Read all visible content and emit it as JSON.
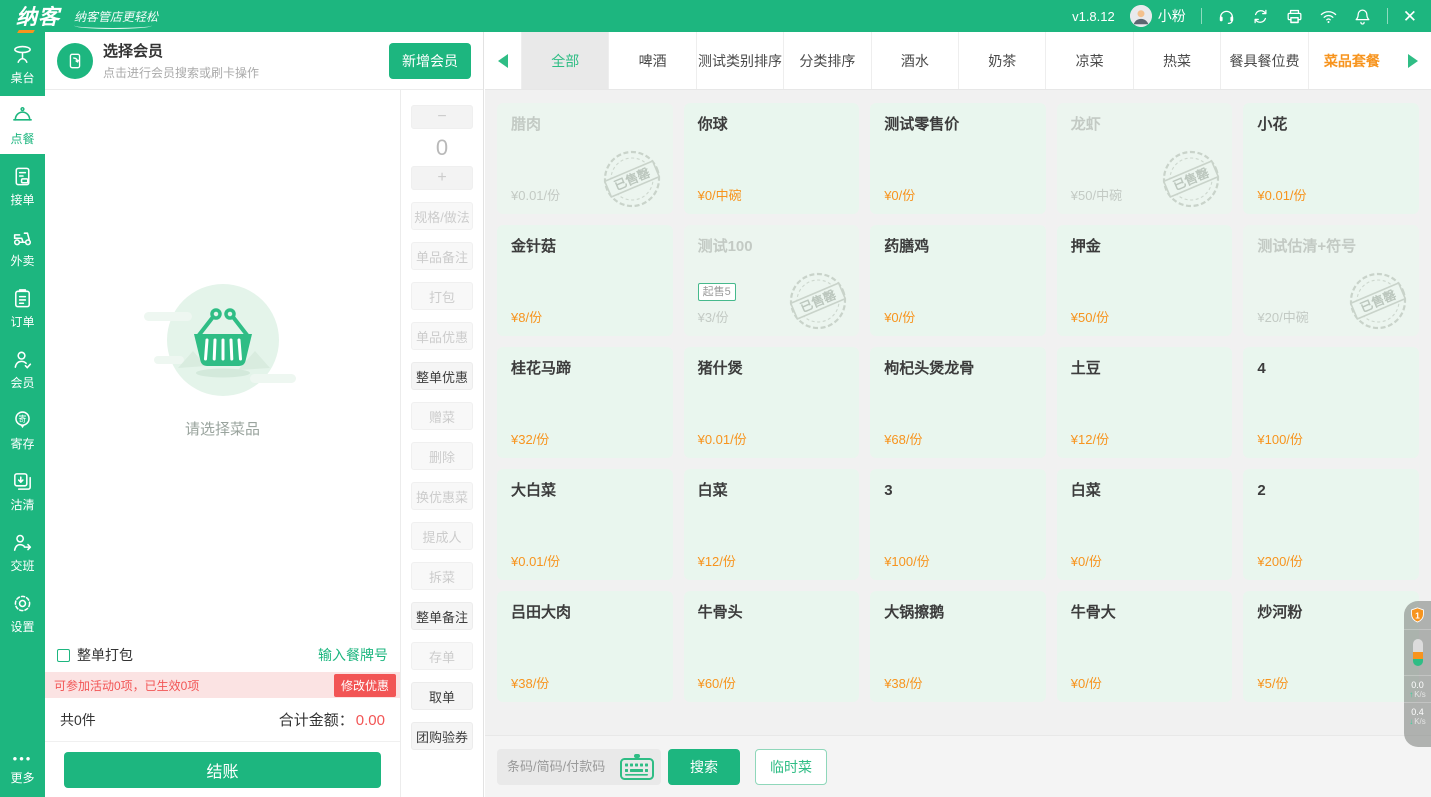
{
  "app": {
    "logo": "纳客",
    "slogan": "纳客管店更轻松",
    "version": "v1.8.12",
    "user": "小粉"
  },
  "sidebar": {
    "items": [
      {
        "id": "tables",
        "label": "桌台",
        "icon": "table-icon",
        "active": false
      },
      {
        "id": "order",
        "label": "点餐",
        "icon": "cloche-icon",
        "active": true
      },
      {
        "id": "accept",
        "label": "接单",
        "icon": "receipt-icon",
        "active": false
      },
      {
        "id": "takeout",
        "label": "外卖",
        "icon": "scooter-icon",
        "active": false
      },
      {
        "id": "orders",
        "label": "订单",
        "icon": "clipboard-icon",
        "active": false
      },
      {
        "id": "members",
        "label": "会员",
        "icon": "member-icon",
        "active": false
      },
      {
        "id": "deposit",
        "label": "寄存",
        "icon": "deposit-pin-icon",
        "active": false
      },
      {
        "id": "sellout",
        "label": "沽清",
        "icon": "soldout-pages-icon",
        "active": false
      },
      {
        "id": "shift",
        "label": "交班",
        "icon": "shift-icon",
        "active": false
      },
      {
        "id": "settings",
        "label": "设置",
        "icon": "gear-icon",
        "active": false
      }
    ],
    "more": {
      "id": "more",
      "label": "更多",
      "icon": "more-dots-icon"
    }
  },
  "member_panel": {
    "title": "选择会员",
    "subtitle": "点击进行会员搜索或刷卡操作",
    "add_button": "新增会员",
    "empty_text": "请选择菜品",
    "pack_label": "整单打包",
    "table_no_link": "输入餐牌号",
    "activity_text": "可参加活动0项，已生效0项",
    "modify_discount": "修改优惠",
    "count_text": "共0件",
    "total_label": "合计金额：",
    "total_value": "0.00",
    "checkout": "结账"
  },
  "actions": {
    "minus_label": "−",
    "qty": "0",
    "plus_label": "+",
    "buttons": [
      {
        "id": "spec",
        "label": "规格/做法",
        "enabled": false
      },
      {
        "id": "item-note",
        "label": "单品备注",
        "enabled": false
      },
      {
        "id": "pack",
        "label": "打包",
        "enabled": false
      },
      {
        "id": "item-discount",
        "label": "单品优惠",
        "enabled": false
      },
      {
        "id": "order-discount",
        "label": "整单优惠",
        "enabled": true
      },
      {
        "id": "gift-dish",
        "label": "赠菜",
        "enabled": false
      },
      {
        "id": "delete",
        "label": "删除",
        "enabled": false
      },
      {
        "id": "swap-discount",
        "label": "换优惠菜",
        "enabled": false
      },
      {
        "id": "commission",
        "label": "提成人",
        "enabled": false
      },
      {
        "id": "split-dish",
        "label": "拆菜",
        "enabled": false
      },
      {
        "id": "order-note",
        "label": "整单备注",
        "enabled": true
      },
      {
        "id": "save-order",
        "label": "存单",
        "enabled": false
      },
      {
        "id": "retrieve-order",
        "label": "取单",
        "enabled": true
      },
      {
        "id": "groupon-verify",
        "label": "团购验券",
        "enabled": true
      }
    ]
  },
  "categories": {
    "tabs": [
      {
        "id": "all",
        "label": "全部",
        "state": "selected"
      },
      {
        "id": "beer",
        "label": "啤酒",
        "state": "normal"
      },
      {
        "id": "test-cat-sort",
        "label": "测试类别排序",
        "state": "normal"
      },
      {
        "id": "cat-sort",
        "label": "分类排序",
        "state": "normal"
      },
      {
        "id": "drinks",
        "label": "酒水",
        "state": "normal"
      },
      {
        "id": "milk-tea",
        "label": "奶茶",
        "state": "normal"
      },
      {
        "id": "cold-dishes",
        "label": "凉菜",
        "state": "normal"
      },
      {
        "id": "hot-dishes",
        "label": "热菜",
        "state": "normal"
      },
      {
        "id": "tableware-fee",
        "label": "餐具餐位费",
        "state": "normal"
      },
      {
        "id": "set-meals",
        "label": "菜品套餐",
        "state": "highlight"
      }
    ]
  },
  "menu": {
    "soldout_stamp": "已售罄",
    "items": [
      {
        "name": "腊肉",
        "price": "¥0.01/份",
        "sold_out": true
      },
      {
        "name": "你球",
        "price": "¥0/中碗",
        "sold_out": false
      },
      {
        "name": "测试零售价",
        "price": "¥0/份",
        "sold_out": false
      },
      {
        "name": "龙虾",
        "price": "¥50/中碗",
        "sold_out": true
      },
      {
        "name": "小花",
        "price": "¥0.01/份",
        "sold_out": false
      },
      {
        "name": "金针菇",
        "price": "¥8/份",
        "sold_out": false
      },
      {
        "name": "测试100",
        "price": "¥3/份",
        "sold_out": true,
        "badge": "起售5"
      },
      {
        "name": "药膳鸡",
        "price": "¥0/份",
        "sold_out": false
      },
      {
        "name": "押金",
        "price": "¥50/份",
        "sold_out": false
      },
      {
        "name": "测试估清+符号",
        "price": "¥20/中碗",
        "sold_out": true
      },
      {
        "name": "桂花马蹄",
        "price": "¥32/份",
        "sold_out": false
      },
      {
        "name": "猪什煲",
        "price": "¥0.01/份",
        "sold_out": false
      },
      {
        "name": "枸杞头煲龙骨",
        "price": "¥68/份",
        "sold_out": false
      },
      {
        "name": "土豆",
        "price": "¥12/份",
        "sold_out": false
      },
      {
        "name": "4",
        "price": "¥100/份",
        "sold_out": false
      },
      {
        "name": "大白菜",
        "price": "¥0.01/份",
        "sold_out": false
      },
      {
        "name": "白菜",
        "price": "¥12/份",
        "sold_out": false
      },
      {
        "name": "3",
        "price": "¥100/份",
        "sold_out": false
      },
      {
        "name": "白菜",
        "price": "¥0/份",
        "sold_out": false
      },
      {
        "name": "2",
        "price": "¥200/份",
        "sold_out": false
      },
      {
        "name": "吕田大肉",
        "price": "¥38/份",
        "sold_out": false
      },
      {
        "name": "牛骨头",
        "price": "¥60/份",
        "sold_out": false
      },
      {
        "name": "大锅擦鹅",
        "price": "¥38/份",
        "sold_out": false
      },
      {
        "name": "牛骨大",
        "price": "¥0/份",
        "sold_out": false
      },
      {
        "name": "炒河粉",
        "price": "¥5/份",
        "sold_out": false
      }
    ]
  },
  "search": {
    "placeholder": "条码/简码/付款码",
    "search_btn": "搜索",
    "temp_dish_btn": "临时菜"
  },
  "net_widget": {
    "badge": "1",
    "up_value": "0.0",
    "up_unit": "K/s",
    "down_value": "0.4",
    "down_unit": "K/s"
  },
  "colors": {
    "primary_green": "#1db67f",
    "accent_orange": "#f7941e",
    "danger_red": "#f25555",
    "card_bg": "#e9f6ee",
    "tab_selected_bg": "#e9e9e9"
  }
}
